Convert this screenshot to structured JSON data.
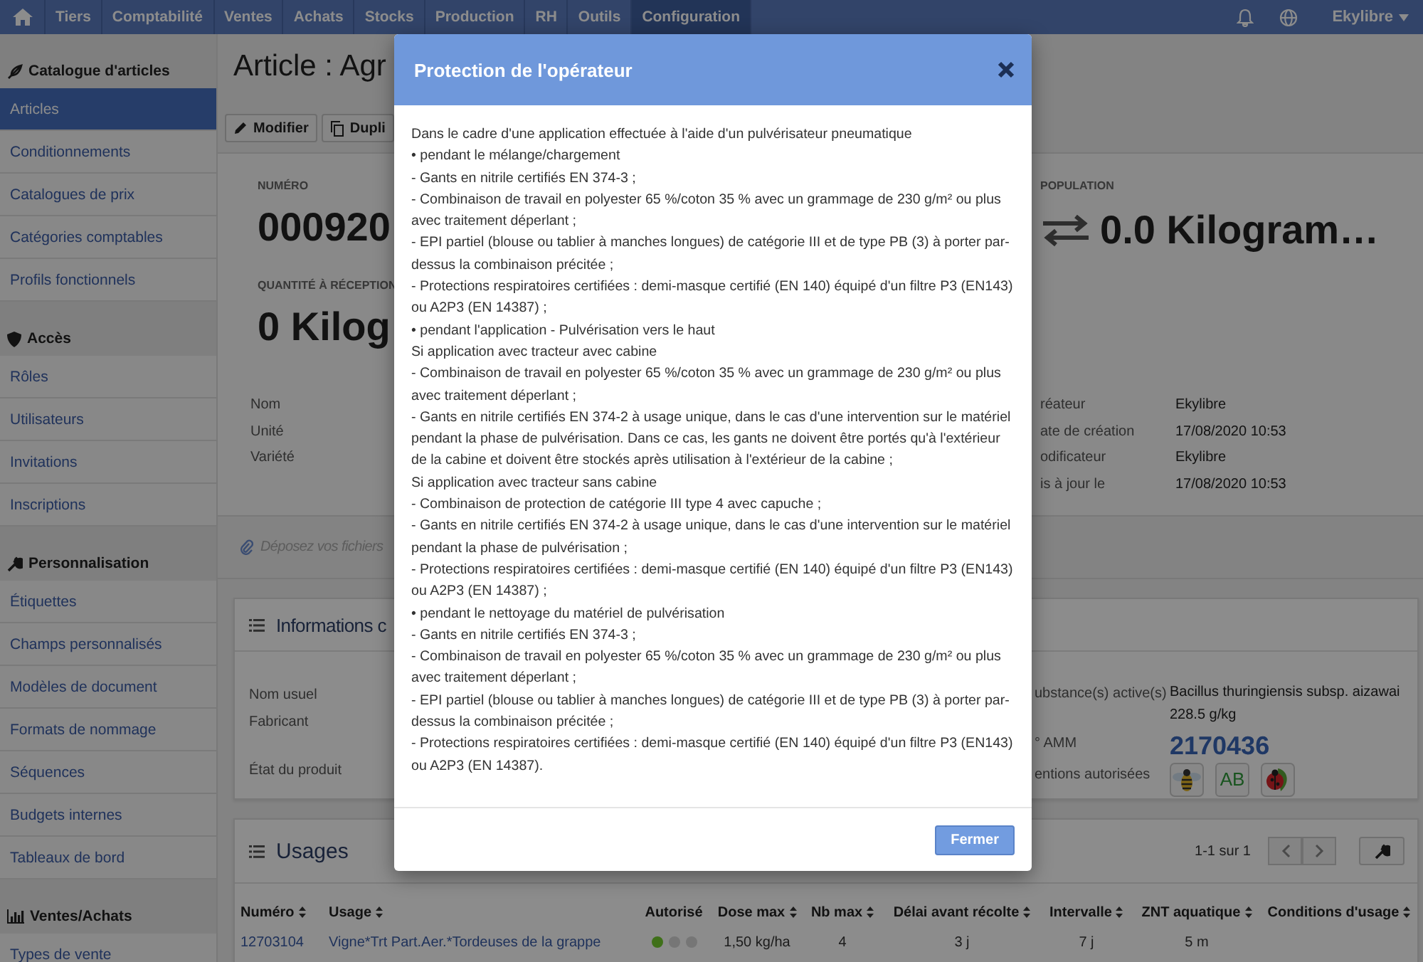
{
  "nav": {
    "tabs": [
      {
        "label": "Tiers",
        "selected": false
      },
      {
        "label": "Comptabilité",
        "selected": false
      },
      {
        "label": "Ventes",
        "selected": false
      },
      {
        "label": "Achats",
        "selected": false
      },
      {
        "label": "Stocks",
        "selected": false
      },
      {
        "label": "Production",
        "selected": false
      },
      {
        "label": "RH",
        "selected": false
      },
      {
        "label": "Outils",
        "selected": false
      },
      {
        "label": "Configuration",
        "selected": true
      }
    ],
    "user": "Ekylibre"
  },
  "sidebar": {
    "sections": [
      {
        "kind": "catalog",
        "title": "Catalogue d'articles",
        "items": [
          {
            "label": "Articles",
            "selected": true
          },
          {
            "label": "Conditionnements",
            "selected": false
          },
          {
            "label": "Catalogues de prix",
            "selected": false
          },
          {
            "label": "Catégories comptables",
            "selected": false
          },
          {
            "label": "Profils fonctionnels",
            "selected": false
          }
        ]
      },
      {
        "kind": "access",
        "title": "Accès",
        "items": [
          {
            "label": "Rôles",
            "selected": false
          },
          {
            "label": "Utilisateurs",
            "selected": false
          },
          {
            "label": "Invitations",
            "selected": false
          },
          {
            "label": "Inscriptions",
            "selected": false
          }
        ]
      },
      {
        "kind": "custom",
        "title": "Personnalisation",
        "items": [
          {
            "label": "Étiquettes",
            "selected": false
          },
          {
            "label": "Champs personnalisés",
            "selected": false
          },
          {
            "label": "Modèles de document",
            "selected": false
          },
          {
            "label": "Formats de nommage",
            "selected": false
          },
          {
            "label": "Séquences",
            "selected": false
          },
          {
            "label": "Budgets internes",
            "selected": false
          },
          {
            "label": "Tableaux de bord",
            "selected": false
          }
        ]
      },
      {
        "kind": "sales",
        "title": "Ventes/Achats",
        "items": [
          {
            "label": "Types de vente",
            "selected": false
          }
        ]
      }
    ]
  },
  "page": {
    "title": "Article : Agr",
    "actions": [
      {
        "kind": "edit",
        "label": "Modifier"
      },
      {
        "kind": "copy",
        "label": "Dupli"
      }
    ]
  },
  "summary": {
    "fields": [
      {
        "label": "NUMÉRO",
        "value": "000920"
      },
      {
        "label": "QUANTITÉ À RÉCEPTION",
        "value": "0 Kilog"
      }
    ],
    "population": {
      "label": "POPULATION",
      "value": "0.0 Kilogram…"
    },
    "left_properties": [
      "Nom",
      "Unité",
      "Variété"
    ],
    "right_properties": [
      {
        "label": "réateur",
        "value": "Ekylibre"
      },
      {
        "label": "ate de création",
        "value": "17/08/2020 10:53"
      },
      {
        "label": "odificateur",
        "value": "Ekylibre"
      },
      {
        "label": "is à jour le",
        "value": "17/08/2020 10:53"
      }
    ]
  },
  "dropzone": {
    "text": "Déposez vos fichiers"
  },
  "informations": {
    "title": "Informations c",
    "left_properties": [
      "Nom usuel",
      "Fabricant",
      "État du produit"
    ],
    "substance": {
      "label": "ubstance(s) active(s)",
      "lines": [
        "Bacillus thuringiensis subsp. aizawai",
        "228.5 g/kg"
      ]
    },
    "amm": {
      "label": "° AMM",
      "value": "2170436"
    },
    "mentions": {
      "label": "entions autorisées",
      "badges": [
        {
          "kind": "bee"
        },
        {
          "kind": "organic",
          "label": "AB"
        },
        {
          "kind": "ladybug"
        }
      ]
    }
  },
  "usages": {
    "title": "Usages",
    "pagination": "1-1 sur 1",
    "columns": [
      "Numéro",
      "Usage",
      "Autorisé",
      "Dose max",
      "Nb max",
      "Délai avant récolte",
      "Intervalle",
      "ZNT aquatique",
      "Conditions d'usage"
    ],
    "rows": [
      {
        "numero": "12703104",
        "usage": "Vigne*Trt Part.Aer.*Tordeuses de la grappe",
        "autorise": [
          {
            "color": "#3f7019"
          },
          {
            "color": "#767676"
          },
          {
            "color": "#767676"
          }
        ],
        "dose_max": "1,50 kg/ha",
        "nb_max": "4",
        "delai": "3 j",
        "intervalle": "7 j",
        "znt": "5 m"
      }
    ]
  },
  "modal": {
    "title": "Protection de l'opérateur",
    "close_button": "Fermer",
    "paragraphs": [
      "Dans le cadre d'une application effectuée à l'aide d'un pulvérisateur pneumatique",
      "• pendant le mélange/chargement",
      "- Gants en nitrile certifiés EN 374-3 ;",
      "- Combinaison de travail en polyester 65 %/coton 35 % avec un grammage de 230 g/m² ou plus avec traitement déperlant ;",
      "- EPI partiel (blouse ou tablier à manches longues) de catégorie III et de type PB (3) à porter par-dessus la combinaison précitée ;",
      "- Protections respiratoires certifiées : demi-masque certifié (EN 140) équipé d'un filtre P3 (EN143) ou A2P3 (EN 14387) ;",
      "• pendant l'application - Pulvérisation vers le haut",
      "Si application avec tracteur avec cabine",
      "- Combinaison de travail en polyester 65 %/coton 35 % avec un grammage de 230 g/m² ou plus avec traitement déperlant ;",
      "- Gants en nitrile certifiés EN 374-2 à usage unique, dans le cas d'une intervention sur le matériel pendant la phase de pulvérisation. Dans ce cas, les gants ne doivent être portés qu'à l'extérieur de la cabine et doivent être stockés après utilisation à l'extérieur de la cabine ;",
      "Si application avec tracteur sans cabine",
      "- Combinaison de protection de catégorie III type 4 avec capuche ;",
      "- Gants en nitrile certifiés EN 374-2 à usage unique, dans le cas d'une intervention sur le matériel pendant la phase de pulvérisation ;",
      "- Protections respiratoires certifiées : demi-masque certifié (EN 140) équipé d'un filtre P3 (EN143) ou A2P3 (EN 14387) ;",
      "• pendant le nettoyage du matériel de pulvérisation",
      "- Gants en nitrile certifiés EN 374-3 ;",
      "- Combinaison de travail en polyester 65 %/coton 35 % avec un grammage de 230 g/m² ou plus avec traitement déperlant ;",
      "- EPI partiel (blouse ou tablier à manches longues) de catégorie III et de type PB (3) à porter par-dessus la combinaison précitée ;",
      "- Protections respiratoires certifiées : demi-masque certifié (EN 140) équipé d'un filtre P3 (EN143) ou A2P3 (EN 14387)."
    ]
  }
}
